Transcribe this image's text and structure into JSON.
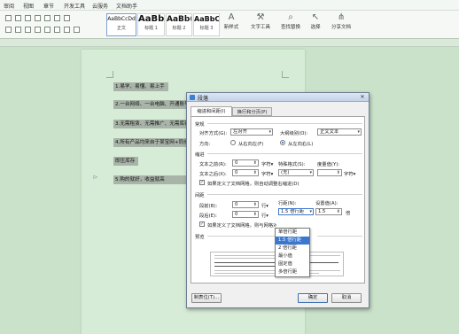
{
  "menu": [
    "审阅",
    "视图",
    "章节",
    "开发工具",
    "云服务",
    "文档助手"
  ],
  "ribbon": {
    "styles": [
      {
        "sample": "AaBbCcDd",
        "name": "正文"
      },
      {
        "sample": "AaBb",
        "name": "标题 1"
      },
      {
        "sample": "AaBb(",
        "name": "标题 2"
      },
      {
        "sample": "AaBbC(",
        "name": "标题 3"
      }
    ],
    "tools": {
      "new_style": "新样式",
      "text_tool": "文字工具",
      "find_replace": "查找替换",
      "select": "选择",
      "share_doc": "分享文档"
    }
  },
  "document": {
    "lines": [
      "1.易学、易懂、易上手",
      "2.一台网络、一台电脑、开通账号",
      "3.无需租赁、无需推广、无需库存",
      "4.所有产品均来自于某宝网+同步",
      "即压库存",
      "5.购的就好，收益就高"
    ]
  },
  "dialog": {
    "title": "段落",
    "close": "✕",
    "tabs": [
      "缩进和间距(I)",
      "换行和分页(P)"
    ],
    "general": {
      "section": "常规",
      "align_label": "对齐方式(G):",
      "align_value": "左对齐",
      "outline_label": "大纲级别(O):",
      "outline_value": "正文文本",
      "dir_label": "方向:",
      "rtl": "从右向左(F)",
      "ltr": "从左向右(L)"
    },
    "indent": {
      "section": "缩进",
      "before_label": "文本之前(R):",
      "before_value": "0",
      "before_unit": "字符▾",
      "special_label": "特殊格式(S):",
      "special_value": "(无)",
      "degree_label": "度量值(Y):",
      "after_label": "文本之后(X):",
      "after_value": "0",
      "after_unit": "字符▾",
      "degree_unit": "字符▾",
      "grid_check": "如果定义了文档网格，则自动调整右缩进(D)"
    },
    "spacing": {
      "section": "间距",
      "before_label": "段前(B):",
      "before_value": "0",
      "before_unit": "行▾",
      "line_label": "行距(N):",
      "line_value": "1.5 倍行距",
      "setting_label": "设置值(A):",
      "setting_value": "1.5",
      "setting_unit": "倍",
      "after_label": "段后(E):",
      "after_value": "0",
      "after_unit": "行▾",
      "grid_check": "如果定义了文档网格，则与网格对齐"
    },
    "preview_label": "预览",
    "line_options": [
      "单倍行距",
      "1.5 倍行距",
      "2 倍行距",
      "最小值",
      "固定值",
      "多倍行距"
    ],
    "selected_option": 1,
    "buttons": {
      "tabs": "制表位(T)...",
      "ok": "确定",
      "cancel": "取消"
    }
  },
  "colors": {
    "desktop_bg": "#c9e2c9",
    "page_bg": "#d7ecd7",
    "highlight": "#a9b4a9",
    "selection": "#3b76cf"
  }
}
